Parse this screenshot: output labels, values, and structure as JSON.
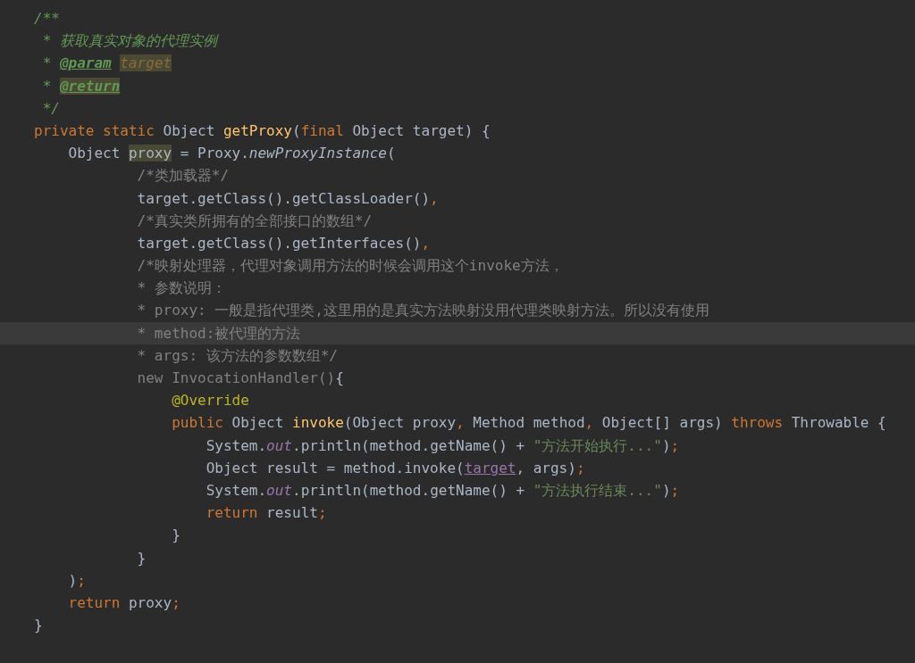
{
  "editor": {
    "lines": [
      {
        "tokens": [
          {
            "text": "/**",
            "kind": "doc"
          }
        ]
      },
      {
        "tokens": [
          {
            "text": " * 获取真实对象的代理实例",
            "kind": "doc"
          }
        ]
      },
      {
        "tokens": [
          {
            "text": " * ",
            "kind": "doc"
          },
          {
            "text": "@param",
            "kind": "tag"
          },
          {
            "text": " target",
            "kind": "parammark"
          }
        ]
      },
      {
        "tokens": [
          {
            "text": " * ",
            "kind": "doc"
          },
          {
            "text": "@return",
            "kind": "tagmark"
          }
        ]
      },
      {
        "tokens": [
          {
            "text": " */",
            "kind": "doc"
          }
        ]
      },
      {
        "tokens": [
          {
            "text": "private static ",
            "kind": "keyword"
          },
          {
            "text": "Object ",
            "kind": "plain"
          },
          {
            "text": "getProxy",
            "kind": "decl"
          },
          {
            "text": "(",
            "kind": "plain"
          },
          {
            "text": "final ",
            "kind": "keyword"
          },
          {
            "text": "Object target) {",
            "kind": "plain"
          }
        ]
      },
      {
        "tokens": [
          {
            "text": "    Object ",
            "kind": "plain"
          },
          {
            "text": "proxy",
            "kind": "varmark"
          },
          {
            "text": " = Proxy.",
            "kind": "plain"
          },
          {
            "text": "newProxyInstance",
            "kind": "italic"
          },
          {
            "text": "(",
            "kind": "plain"
          }
        ]
      },
      {
        "tokens": [
          {
            "text": "            /*类加载器*/",
            "kind": "comment"
          }
        ]
      },
      {
        "tokens": [
          {
            "text": "            target.getClass().getClassLoader()",
            "kind": "plain"
          },
          {
            "text": ",",
            "kind": "punct"
          }
        ]
      },
      {
        "tokens": [
          {
            "text": "            /*真实类所拥有的全部接口的数组*/",
            "kind": "comment"
          }
        ]
      },
      {
        "tokens": [
          {
            "text": "            target.getClass().getInterfaces()",
            "kind": "plain"
          },
          {
            "text": ",",
            "kind": "punct"
          }
        ]
      },
      {
        "tokens": [
          {
            "text": "            /*映射处理器，代理对象调用方法的时候会调用这个invoke方法，",
            "kind": "comment"
          }
        ]
      },
      {
        "tokens": [
          {
            "text": "            * 参数说明：",
            "kind": "comment"
          }
        ]
      },
      {
        "tokens": [
          {
            "text": "            * proxy: 一般是指代理类,这里用的是真实方法映射没用代理类映射方法。所以没有使用",
            "kind": "comment"
          }
        ]
      },
      {
        "current": true,
        "tokens": [
          {
            "text": "            * method:被代理的方法",
            "kind": "comment"
          }
        ]
      },
      {
        "tokens": [
          {
            "text": "            * args: 该方法的参数数组*/",
            "kind": "comment"
          }
        ]
      },
      {
        "tokens": [
          {
            "text": "            new InvocationHandler()",
            "kind": "faded"
          },
          {
            "text": "{",
            "kind": "plain"
          }
        ]
      },
      {
        "tokens": [
          {
            "text": "                @Override",
            "kind": "annotation"
          }
        ]
      },
      {
        "tokens": [
          {
            "text": "                public ",
            "kind": "keyword"
          },
          {
            "text": "Object ",
            "kind": "plain"
          },
          {
            "text": "invoke",
            "kind": "decl"
          },
          {
            "text": "(Object proxy",
            "kind": "plain"
          },
          {
            "text": ", ",
            "kind": "punct"
          },
          {
            "text": "Method method",
            "kind": "plain"
          },
          {
            "text": ", ",
            "kind": "punct"
          },
          {
            "text": "Object[] args) ",
            "kind": "plain"
          },
          {
            "text": "throws ",
            "kind": "keyword"
          },
          {
            "text": "Throwable {",
            "kind": "plain"
          }
        ]
      },
      {
        "tokens": [
          {
            "text": "                    System.",
            "kind": "plain"
          },
          {
            "text": "out",
            "kind": "static"
          },
          {
            "text": ".println(method.getName() + ",
            "kind": "plain"
          },
          {
            "text": "\"方法开始执行...\"",
            "kind": "string"
          },
          {
            "text": ")",
            "kind": "plain"
          },
          {
            "text": ";",
            "kind": "punct"
          }
        ]
      },
      {
        "tokens": [
          {
            "text": "                    Object result = method.invoke(",
            "kind": "plain"
          },
          {
            "text": "target",
            "kind": "field"
          },
          {
            "text": ", args)",
            "kind": "plain"
          },
          {
            "text": ";",
            "kind": "punct"
          }
        ]
      },
      {
        "tokens": [
          {
            "text": "                    System.",
            "kind": "plain"
          },
          {
            "text": "out",
            "kind": "static"
          },
          {
            "text": ".println(method.getName() + ",
            "kind": "plain"
          },
          {
            "text": "\"方法执行结束...\"",
            "kind": "string"
          },
          {
            "text": ")",
            "kind": "plain"
          },
          {
            "text": ";",
            "kind": "punct"
          }
        ]
      },
      {
        "tokens": [
          {
            "text": "                    return ",
            "kind": "keyword"
          },
          {
            "text": "result",
            "kind": "plain"
          },
          {
            "text": ";",
            "kind": "punct"
          }
        ]
      },
      {
        "tokens": [
          {
            "text": "                }",
            "kind": "plain"
          }
        ]
      },
      {
        "tokens": [
          {
            "text": "            }",
            "kind": "plain"
          }
        ]
      },
      {
        "tokens": [
          {
            "text": "    )",
            "kind": "plain"
          },
          {
            "text": ";",
            "kind": "punct"
          }
        ]
      },
      {
        "tokens": [
          {
            "text": "    return ",
            "kind": "keyword"
          },
          {
            "text": "proxy",
            "kind": "plain"
          },
          {
            "text": ";",
            "kind": "punct"
          }
        ]
      },
      {
        "tokens": [
          {
            "text": "}",
            "kind": "plain"
          }
        ]
      }
    ]
  }
}
